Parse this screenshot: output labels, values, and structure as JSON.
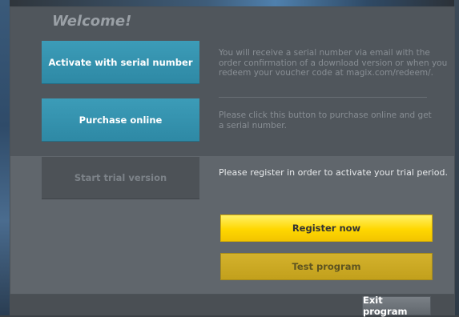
{
  "title": "Welcome!",
  "options": [
    {
      "button_label": "Activate with serial number",
      "description": "You will receive a serial number via email with the order confirmation of a download version or when you redeem your voucher code at magix.com/redeem/."
    },
    {
      "button_label": "Purchase online",
      "description": "Please click this button to purchase online and get a serial number."
    },
    {
      "button_label": "Start trial version",
      "description": "Please register in order to activate your trial period."
    }
  ],
  "actions": {
    "register_label": "Register now",
    "test_label": "Test program"
  },
  "footer": {
    "exit_label": "Exit program"
  },
  "colors": {
    "accent_blue": "#3c9cb8",
    "accent_yellow": "#ffd700"
  }
}
